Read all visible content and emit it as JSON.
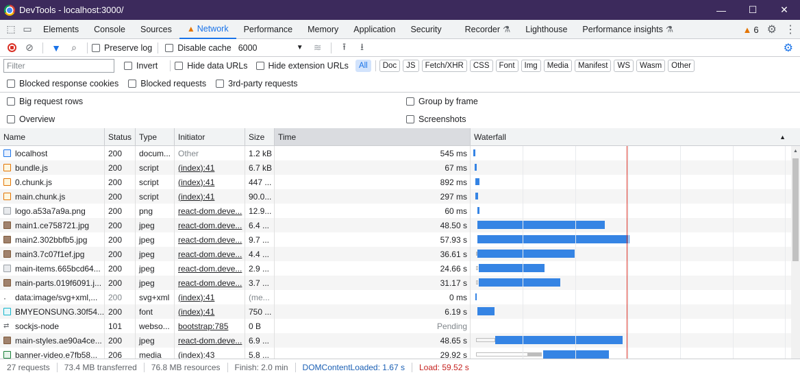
{
  "window": {
    "title": "DevTools - localhost:3000/",
    "minimize": "—",
    "maximize": "☐",
    "close": "✕"
  },
  "tabs": [
    "Elements",
    "Console",
    "Sources",
    "Network",
    "Performance",
    "Memory",
    "Application",
    "Security",
    "Recorder",
    "Lighthouse",
    "Performance insights"
  ],
  "active_tab": "Network",
  "issues_count": "6",
  "toolbar": {
    "preserve_log": "Preserve log",
    "disable_cache": "Disable cache",
    "throttle": "6000"
  },
  "filter": {
    "placeholder": "Filter",
    "invert": "Invert",
    "hide_data_urls": "Hide data URLs",
    "hide_ext_urls": "Hide extension URLs",
    "types": [
      "All",
      "Doc",
      "JS",
      "Fetch/XHR",
      "CSS",
      "Font",
      "Img",
      "Media",
      "Manifest",
      "WS",
      "Wasm",
      "Other"
    ],
    "active_type": "All"
  },
  "options": {
    "blocked_cookies": "Blocked response cookies",
    "blocked_requests": "Blocked requests",
    "third_party": "3rd-party requests",
    "big_rows": "Big request rows",
    "group_frame": "Group by frame",
    "overview": "Overview",
    "screenshots": "Screenshots"
  },
  "columns": {
    "name": "Name",
    "status": "Status",
    "type": "Type",
    "initiator": "Initiator",
    "size": "Size",
    "time": "Time",
    "waterfall": "Waterfall"
  },
  "rows": [
    {
      "name": "localhost",
      "status": "200",
      "type": "docum...",
      "initiator": "Other",
      "size": "1.2 kB",
      "time": "545 ms",
      "icon": "doc"
    },
    {
      "name": "bundle.js",
      "status": "200",
      "type": "script",
      "initiator": "(index):41",
      "size": "6.7 kB",
      "time": "67 ms",
      "icon": "script"
    },
    {
      "name": "0.chunk.js",
      "status": "200",
      "type": "script",
      "initiator": "(index):41",
      "size": "447 ...",
      "time": "892 ms",
      "icon": "script"
    },
    {
      "name": "main.chunk.js",
      "status": "200",
      "type": "script",
      "initiator": "(index):41",
      "size": "90.0...",
      "time": "297 ms",
      "icon": "script"
    },
    {
      "name": "logo.a53a7a9a.png",
      "status": "200",
      "type": "png",
      "initiator": "react-dom.deve...",
      "size": "12.9...",
      "time": "60 ms",
      "icon": "imgl"
    },
    {
      "name": "main1.ce758721.jpg",
      "status": "200",
      "type": "jpeg",
      "initiator": "react-dom.deve...",
      "size": "6.4 ...",
      "time": "48.50 s",
      "icon": "img"
    },
    {
      "name": "main2.302bbfb5.jpg",
      "status": "200",
      "type": "jpeg",
      "initiator": "react-dom.deve...",
      "size": "9.7 ...",
      "time": "57.93 s",
      "icon": "img"
    },
    {
      "name": "main3.7c07f1ef.jpg",
      "status": "200",
      "type": "jpeg",
      "initiator": "react-dom.deve...",
      "size": "4.4 ...",
      "time": "36.61 s",
      "icon": "img"
    },
    {
      "name": "main-items.665bcd64...",
      "status": "200",
      "type": "jpeg",
      "initiator": "react-dom.deve...",
      "size": "2.9 ...",
      "time": "24.66 s",
      "icon": "imgl"
    },
    {
      "name": "main-parts.019f6091.j...",
      "status": "200",
      "type": "jpeg",
      "initiator": "react-dom.deve...",
      "size": "3.7 ...",
      "time": "31.17 s",
      "icon": "img"
    },
    {
      "name": "data:image/svg+xml,...",
      "status": "200",
      "type": "svg+xml",
      "initiator": "(index):41",
      "size": "(me...",
      "time": "0 ms",
      "icon": "none"
    },
    {
      "name": "BMYEONSUNG.30f54...",
      "status": "200",
      "type": "font",
      "initiator": "(index):41",
      "size": "750 ...",
      "time": "6.19 s",
      "icon": "font"
    },
    {
      "name": "sockjs-node",
      "status": "101",
      "type": "webso...",
      "initiator": "bootstrap:785",
      "size": "0 B",
      "time": "Pending",
      "icon": "ws"
    },
    {
      "name": "main-styles.ae90a4ce...",
      "status": "200",
      "type": "jpeg",
      "initiator": "react-dom.deve...",
      "size": "6.9 ...",
      "time": "48.65 s",
      "icon": "img"
    },
    {
      "name": "banner-video.e7fb58...",
      "status": "206",
      "type": "media",
      "initiator": "(index):43",
      "size": "5.8 ...",
      "time": "29.92 s",
      "icon": "media"
    }
  ],
  "status_bar": {
    "requests": "27 requests",
    "transferred": "73.4 MB transferred",
    "resources": "76.8 MB resources",
    "finish": "Finish: 2.0 min",
    "dcl": "DOMContentLoaded: 1.67 s",
    "load": "Load: 59.52 s"
  }
}
